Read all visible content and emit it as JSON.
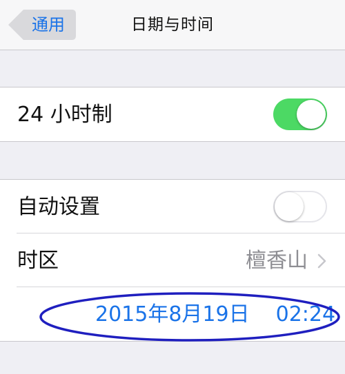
{
  "nav": {
    "back_label": "通用",
    "title": "日期与时间"
  },
  "settings": {
    "clock_24h": {
      "label": "24 小时制",
      "enabled": true
    },
    "auto_set": {
      "label": "自动设置",
      "enabled": false
    },
    "timezone": {
      "label": "时区",
      "value": "檀香山"
    },
    "datetime": {
      "date": "2015年8月19日",
      "time": "02:24"
    }
  },
  "colors": {
    "accent": "#1a73e8",
    "toggle_on": "#4cd964",
    "annotation_ellipse": "#1f1fbf"
  }
}
